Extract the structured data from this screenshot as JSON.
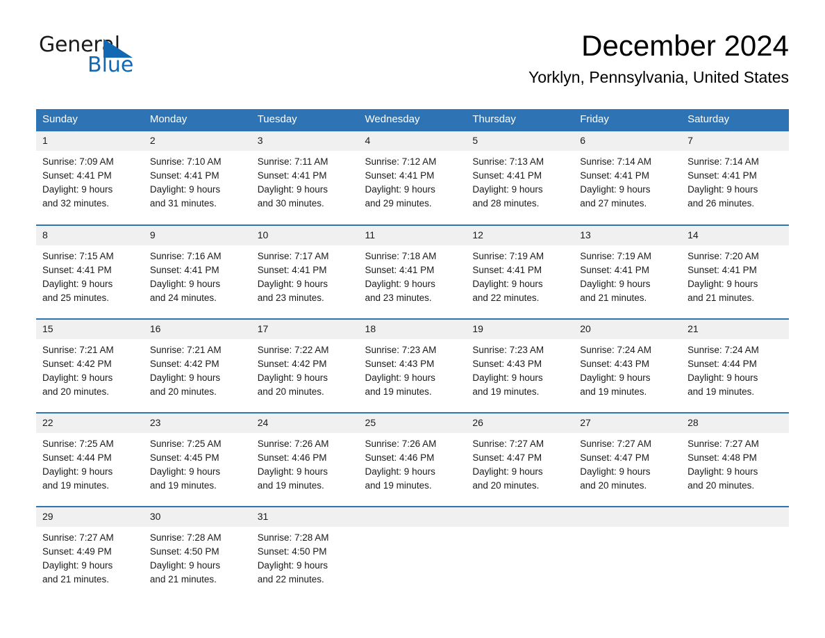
{
  "brand": {
    "name_dark": "General",
    "name_light": "Blue",
    "triangle_color": "#1268b3",
    "text_color": "#1a1a1a"
  },
  "header": {
    "title": "December 2024",
    "subtitle": "Yorklyn, Pennsylvania, United States",
    "accent_color": "#2e74b5"
  },
  "calendar": {
    "weekday_headers": [
      "Sunday",
      "Monday",
      "Tuesday",
      "Wednesday",
      "Thursday",
      "Friday",
      "Saturday"
    ],
    "header_bg": "#2e74b5",
    "header_text": "#ffffff",
    "daynum_bg": "#f0f0f0",
    "row_border": "#2e74b5",
    "weeks": [
      [
        {
          "day": "1",
          "sunrise": "Sunrise: 7:09 AM",
          "sunset": "Sunset: 4:41 PM",
          "daylight_1": "Daylight: 9 hours",
          "daylight_2": "and 32 minutes."
        },
        {
          "day": "2",
          "sunrise": "Sunrise: 7:10 AM",
          "sunset": "Sunset: 4:41 PM",
          "daylight_1": "Daylight: 9 hours",
          "daylight_2": "and 31 minutes."
        },
        {
          "day": "3",
          "sunrise": "Sunrise: 7:11 AM",
          "sunset": "Sunset: 4:41 PM",
          "daylight_1": "Daylight: 9 hours",
          "daylight_2": "and 30 minutes."
        },
        {
          "day": "4",
          "sunrise": "Sunrise: 7:12 AM",
          "sunset": "Sunset: 4:41 PM",
          "daylight_1": "Daylight: 9 hours",
          "daylight_2": "and 29 minutes."
        },
        {
          "day": "5",
          "sunrise": "Sunrise: 7:13 AM",
          "sunset": "Sunset: 4:41 PM",
          "daylight_1": "Daylight: 9 hours",
          "daylight_2": "and 28 minutes."
        },
        {
          "day": "6",
          "sunrise": "Sunrise: 7:14 AM",
          "sunset": "Sunset: 4:41 PM",
          "daylight_1": "Daylight: 9 hours",
          "daylight_2": "and 27 minutes."
        },
        {
          "day": "7",
          "sunrise": "Sunrise: 7:14 AM",
          "sunset": "Sunset: 4:41 PM",
          "daylight_1": "Daylight: 9 hours",
          "daylight_2": "and 26 minutes."
        }
      ],
      [
        {
          "day": "8",
          "sunrise": "Sunrise: 7:15 AM",
          "sunset": "Sunset: 4:41 PM",
          "daylight_1": "Daylight: 9 hours",
          "daylight_2": "and 25 minutes."
        },
        {
          "day": "9",
          "sunrise": "Sunrise: 7:16 AM",
          "sunset": "Sunset: 4:41 PM",
          "daylight_1": "Daylight: 9 hours",
          "daylight_2": "and 24 minutes."
        },
        {
          "day": "10",
          "sunrise": "Sunrise: 7:17 AM",
          "sunset": "Sunset: 4:41 PM",
          "daylight_1": "Daylight: 9 hours",
          "daylight_2": "and 23 minutes."
        },
        {
          "day": "11",
          "sunrise": "Sunrise: 7:18 AM",
          "sunset": "Sunset: 4:41 PM",
          "daylight_1": "Daylight: 9 hours",
          "daylight_2": "and 23 minutes."
        },
        {
          "day": "12",
          "sunrise": "Sunrise: 7:19 AM",
          "sunset": "Sunset: 4:41 PM",
          "daylight_1": "Daylight: 9 hours",
          "daylight_2": "and 22 minutes."
        },
        {
          "day": "13",
          "sunrise": "Sunrise: 7:19 AM",
          "sunset": "Sunset: 4:41 PM",
          "daylight_1": "Daylight: 9 hours",
          "daylight_2": "and 21 minutes."
        },
        {
          "day": "14",
          "sunrise": "Sunrise: 7:20 AM",
          "sunset": "Sunset: 4:41 PM",
          "daylight_1": "Daylight: 9 hours",
          "daylight_2": "and 21 minutes."
        }
      ],
      [
        {
          "day": "15",
          "sunrise": "Sunrise: 7:21 AM",
          "sunset": "Sunset: 4:42 PM",
          "daylight_1": "Daylight: 9 hours",
          "daylight_2": "and 20 minutes."
        },
        {
          "day": "16",
          "sunrise": "Sunrise: 7:21 AM",
          "sunset": "Sunset: 4:42 PM",
          "daylight_1": "Daylight: 9 hours",
          "daylight_2": "and 20 minutes."
        },
        {
          "day": "17",
          "sunrise": "Sunrise: 7:22 AM",
          "sunset": "Sunset: 4:42 PM",
          "daylight_1": "Daylight: 9 hours",
          "daylight_2": "and 20 minutes."
        },
        {
          "day": "18",
          "sunrise": "Sunrise: 7:23 AM",
          "sunset": "Sunset: 4:43 PM",
          "daylight_1": "Daylight: 9 hours",
          "daylight_2": "and 19 minutes."
        },
        {
          "day": "19",
          "sunrise": "Sunrise: 7:23 AM",
          "sunset": "Sunset: 4:43 PM",
          "daylight_1": "Daylight: 9 hours",
          "daylight_2": "and 19 minutes."
        },
        {
          "day": "20",
          "sunrise": "Sunrise: 7:24 AM",
          "sunset": "Sunset: 4:43 PM",
          "daylight_1": "Daylight: 9 hours",
          "daylight_2": "and 19 minutes."
        },
        {
          "day": "21",
          "sunrise": "Sunrise: 7:24 AM",
          "sunset": "Sunset: 4:44 PM",
          "daylight_1": "Daylight: 9 hours",
          "daylight_2": "and 19 minutes."
        }
      ],
      [
        {
          "day": "22",
          "sunrise": "Sunrise: 7:25 AM",
          "sunset": "Sunset: 4:44 PM",
          "daylight_1": "Daylight: 9 hours",
          "daylight_2": "and 19 minutes."
        },
        {
          "day": "23",
          "sunrise": "Sunrise: 7:25 AM",
          "sunset": "Sunset: 4:45 PM",
          "daylight_1": "Daylight: 9 hours",
          "daylight_2": "and 19 minutes."
        },
        {
          "day": "24",
          "sunrise": "Sunrise: 7:26 AM",
          "sunset": "Sunset: 4:46 PM",
          "daylight_1": "Daylight: 9 hours",
          "daylight_2": "and 19 minutes."
        },
        {
          "day": "25",
          "sunrise": "Sunrise: 7:26 AM",
          "sunset": "Sunset: 4:46 PM",
          "daylight_1": "Daylight: 9 hours",
          "daylight_2": "and 19 minutes."
        },
        {
          "day": "26",
          "sunrise": "Sunrise: 7:27 AM",
          "sunset": "Sunset: 4:47 PM",
          "daylight_1": "Daylight: 9 hours",
          "daylight_2": "and 20 minutes."
        },
        {
          "day": "27",
          "sunrise": "Sunrise: 7:27 AM",
          "sunset": "Sunset: 4:47 PM",
          "daylight_1": "Daylight: 9 hours",
          "daylight_2": "and 20 minutes."
        },
        {
          "day": "28",
          "sunrise": "Sunrise: 7:27 AM",
          "sunset": "Sunset: 4:48 PM",
          "daylight_1": "Daylight: 9 hours",
          "daylight_2": "and 20 minutes."
        }
      ],
      [
        {
          "day": "29",
          "sunrise": "Sunrise: 7:27 AM",
          "sunset": "Sunset: 4:49 PM",
          "daylight_1": "Daylight: 9 hours",
          "daylight_2": "and 21 minutes."
        },
        {
          "day": "30",
          "sunrise": "Sunrise: 7:28 AM",
          "sunset": "Sunset: 4:50 PM",
          "daylight_1": "Daylight: 9 hours",
          "daylight_2": "and 21 minutes."
        },
        {
          "day": "31",
          "sunrise": "Sunrise: 7:28 AM",
          "sunset": "Sunset: 4:50 PM",
          "daylight_1": "Daylight: 9 hours",
          "daylight_2": "and 22 minutes."
        },
        {
          "day": "",
          "sunrise": "",
          "sunset": "",
          "daylight_1": "",
          "daylight_2": ""
        },
        {
          "day": "",
          "sunrise": "",
          "sunset": "",
          "daylight_1": "",
          "daylight_2": ""
        },
        {
          "day": "",
          "sunrise": "",
          "sunset": "",
          "daylight_1": "",
          "daylight_2": ""
        },
        {
          "day": "",
          "sunrise": "",
          "sunset": "",
          "daylight_1": "",
          "daylight_2": ""
        }
      ]
    ]
  }
}
